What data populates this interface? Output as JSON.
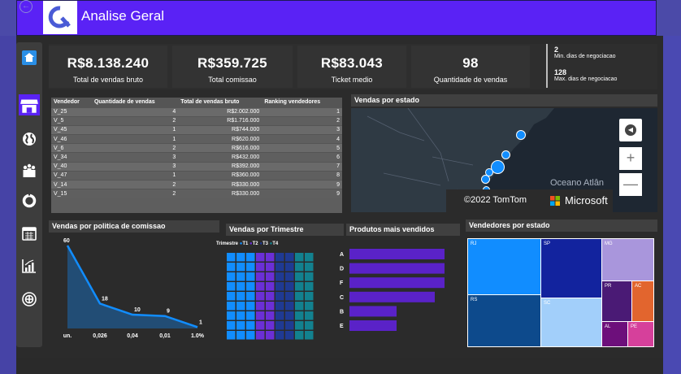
{
  "header": {
    "title": "Analise Geral",
    "back_icon": "back-arrow-icon",
    "accent": "#5a22f5"
  },
  "kpis": [
    {
      "value": "R$8.138.240",
      "label": "Total de vendas bruto"
    },
    {
      "value": "R$359.725",
      "label": "Total comissao"
    },
    {
      "value": "R$83.043",
      "label": "Ticket medio"
    },
    {
      "value": "98",
      "label": "Quantidade de vendas"
    }
  ],
  "side_kpis": [
    {
      "value": "2",
      "label": "Min. dias de negociacao"
    },
    {
      "value": "128",
      "label": "Max. dias de negociacao"
    }
  ],
  "nav": [
    "home-icon",
    "store-icon",
    "globe-icon",
    "team-icon",
    "donut-icon",
    "calendar-icon",
    "bar-chart-icon",
    "target-icon"
  ],
  "sellers_table": {
    "columns": [
      "Vendedor",
      "Quantidade de vendas",
      "Total de vendas bruto",
      "Ranking vendedores"
    ],
    "rows": [
      [
        "V_25",
        "4",
        "R$2.002.000",
        "1"
      ],
      [
        "V_5",
        "2",
        "R$1.716.000",
        "2"
      ],
      [
        "V_45",
        "1",
        "R$744.000",
        "3"
      ],
      [
        "V_46",
        "1",
        "R$620.000",
        "4"
      ],
      [
        "V_6",
        "2",
        "R$616.000",
        "5"
      ],
      [
        "V_34",
        "3",
        "R$432.000",
        "6"
      ],
      [
        "V_40",
        "3",
        "R$392.000",
        "7"
      ],
      [
        "V_47",
        "1",
        "R$360.000",
        "8"
      ],
      [
        "V_14",
        "2",
        "R$330.000",
        "9"
      ],
      [
        "V_15",
        "2",
        "R$330.000",
        "9"
      ]
    ]
  },
  "map": {
    "title": "Vendas por estado",
    "ocean_label": "Oceano Atlân",
    "attribution_tomtom": "©2022 TomTom",
    "attribution_ms": "Microsoft"
  },
  "panels": {
    "comissao_title": "Vendas por politica de comissao",
    "trimestre_title": "Vendas por Trimestre",
    "produtos_title": "Produtos mais vendidos",
    "vendedores_estado_title": "Vendedores por estado"
  },
  "chart_data": [
    {
      "type": "area",
      "title": "Vendas por politica de comissao",
      "categories": [
        "un.",
        "0,026",
        "0,04",
        "0,01",
        "1.0%"
      ],
      "values": [
        60,
        18,
        10,
        9,
        1
      ],
      "data_labels": [
        "60",
        "18",
        "10",
        "9",
        "1"
      ],
      "color": "#118dff"
    },
    {
      "type": "heatmap",
      "title": "Vendas por Trimestre",
      "legend_title": "Trimestre",
      "series": [
        {
          "name": "T1",
          "color": "#118dff"
        },
        {
          "name": "T2",
          "color": "#6b2fd6"
        },
        {
          "name": "T3",
          "color": "#1f3a93"
        },
        {
          "name": "T4",
          "color": "#12818f"
        }
      ]
    },
    {
      "type": "bar",
      "title": "Produtos mais vendidos",
      "categories": [
        "A",
        "D",
        "F",
        "C",
        "B",
        "E"
      ],
      "values": [
        117,
        117,
        117,
        105,
        58,
        58
      ],
      "color": "#5a22c8"
    },
    {
      "type": "heatmap",
      "title": "Vendedores por estado",
      "categories": [
        "RJ",
        "SP",
        "MG",
        "RS",
        "SC",
        "PR",
        "AC",
        "AL",
        "PE"
      ]
    }
  ]
}
